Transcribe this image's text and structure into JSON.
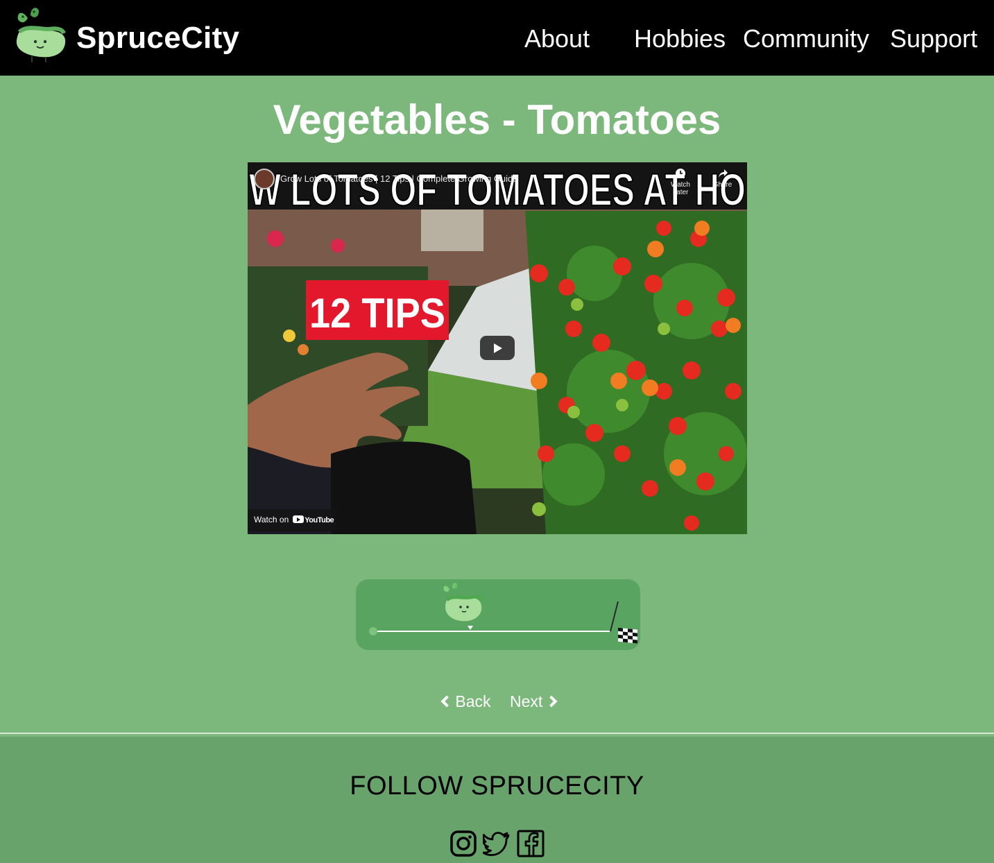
{
  "header": {
    "brand": "SpruceCity",
    "nav": [
      {
        "label": "About"
      },
      {
        "label": "Hobbies"
      },
      {
        "label": "Community"
      },
      {
        "label": "Support"
      }
    ]
  },
  "main": {
    "title": "Vegetables - Tomatoes",
    "video": {
      "title": "Grow Lots of Tomatoes | 12 Tips | Complete Growing Guide",
      "banner_text": "W LOTS OF TOMATOES AT HO",
      "badge_text": "12 TIPS",
      "watch_later": "Watch Later",
      "share": "Share",
      "watch_on": "Watch on",
      "youtube": "YouTube"
    },
    "progress": {
      "fraction": 0.4
    },
    "pager": {
      "back": "Back",
      "next": "Next"
    }
  },
  "footer": {
    "title": "FOLLOW SPRUCECITY",
    "social": [
      "instagram-icon",
      "twitter-icon",
      "facebook-icon"
    ]
  },
  "colors": {
    "page_bg": "#7cb77b",
    "header_bg": "#000000",
    "card_bg": "#5aa461",
    "footer_bg": "#67a36b"
  }
}
